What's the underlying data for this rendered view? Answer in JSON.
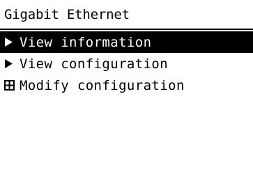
{
  "header": {
    "title": "Gigabit Ethernet"
  },
  "menu": {
    "items": [
      {
        "label": "View information",
        "icon": "arrow-right-icon",
        "selected": true
      },
      {
        "label": "View configuration",
        "icon": "arrow-right-icon",
        "selected": false
      },
      {
        "label": "Modify configuration",
        "icon": "submenu-box-icon",
        "selected": false
      }
    ]
  },
  "colors": {
    "background": "#ffffff",
    "text": "#000000",
    "selected_background": "#000000",
    "selected_text": "#ffffff"
  }
}
